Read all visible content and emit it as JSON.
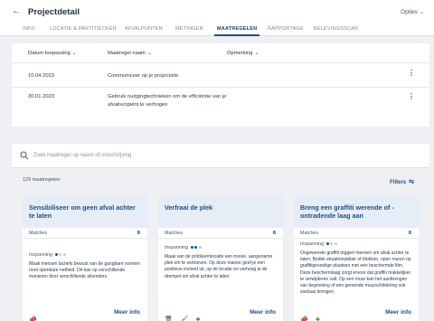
{
  "header": {
    "back_icon": "arrow-left-icon",
    "title": "Projectdetail",
    "options_label": "Opties"
  },
  "tabs": [
    {
      "label": "INFO",
      "active": false
    },
    {
      "label": "LOCATIE & PARTITIECKEN",
      "active": false
    },
    {
      "label": "AFVALPUNTEN",
      "active": false
    },
    {
      "label": "METINGEN",
      "active": false
    },
    {
      "label": "MAATREGELEN",
      "active": true
    },
    {
      "label": "RAPPORTAGE",
      "active": false
    },
    {
      "label": "BELEVINGSSCAN",
      "active": false
    }
  ],
  "measures_table": {
    "columns": [
      "Datum toepassing",
      "Maatregel naam",
      "Opmerking"
    ],
    "rows": [
      {
        "date": "10.04.2023",
        "name": "Communiceer op je projectsite",
        "note": ""
      },
      {
        "date": "30.01.2023",
        "name": "Gebruik nudgingtechnieken om de efficiëntie van je afvalrecipiënt te verhogen",
        "note": ""
      }
    ]
  },
  "search": {
    "placeholder": "Zoek maatregel op naam of omschrijving"
  },
  "results": {
    "count_label": "129 maatregelen",
    "filters_label": "Filters"
  },
  "cards": [
    {
      "title": "Sensibiliseer om geen afval achter te laten",
      "matches_label": "Matches",
      "matches_value": "8",
      "inspiration_label": "Inspanning",
      "inspiration_level": 1,
      "description": "Maak mensen lactiefs bewust van de gangbare normen rond openbare netheid. Dit kan op verschillende manieren door verschillende afzenders.",
      "more_label": "Meer info",
      "icons": [
        "megaphone-icon"
      ]
    },
    {
      "title": "Verfraai de plek",
      "matches_label": "Matches",
      "matches_value": "8",
      "inspiration_label": "Inspanning",
      "inspiration_level": 2,
      "description": "Maak van de probleemlocatie een mooie, aangename plek om te vertoeven. Op deze manier geef je een positieve invloed uit, op de locatie en verhoog je de drempel om afval achter te laten.",
      "more_label": "Meer info",
      "icons": [
        "trash-bin-icon",
        "brush-icon",
        "tree-icon"
      ]
    },
    {
      "title": "Breng een graffiti werende of -ontradende laag aan",
      "matches_label": "Matches",
      "matches_value": "8",
      "inspiration_label": "Inspanning",
      "inspiration_level": 1,
      "description": "Ongewenste graffiti triggert mensen om afval achter te laten. Bedek straatmeubilair of blokken, open muren op graffitigevoelige plaatsen met een beschermde film. Deze beschermlaag zorgt ervoor dat graffiti makkelijker te verwijderen valt. Op een muur kan het aanbrengen van begroeiing of een gemende muurschildering ook soelaas brengen.",
      "more_label": "Meer info",
      "icons": [
        "megaphone-icon",
        "tree-icon"
      ]
    }
  ]
}
